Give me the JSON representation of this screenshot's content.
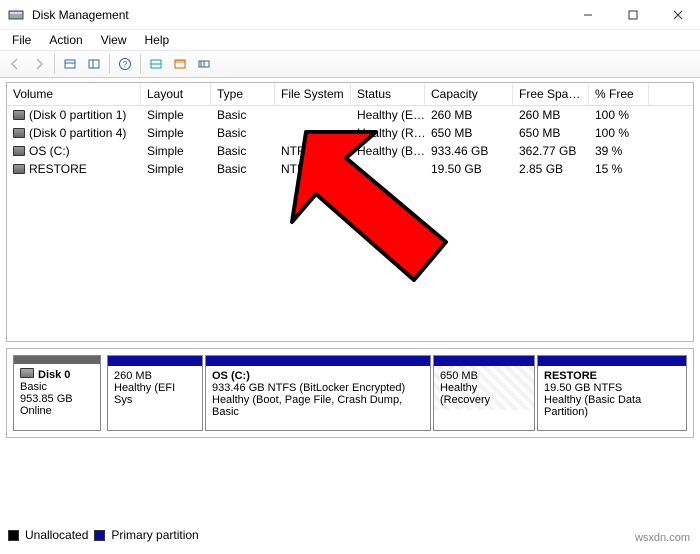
{
  "window": {
    "title": "Disk Management",
    "controls": {
      "minimize": "–",
      "maximize": "☐",
      "close": "✕"
    }
  },
  "menubar": {
    "items": [
      "File",
      "Action",
      "View",
      "Help"
    ]
  },
  "columns": {
    "volume": "Volume",
    "layout": "Layout",
    "type": "Type",
    "filesystem": "File System",
    "status": "Status",
    "capacity": "Capacity",
    "freespace": "Free Spa…",
    "pctfree": "% Free"
  },
  "volumes": [
    {
      "name": "(Disk 0 partition 1)",
      "layout": "Simple",
      "type": "Basic",
      "fs": "",
      "status": "Healthy (E…",
      "capacity": "260 MB",
      "free": "260 MB",
      "pct": "100 %"
    },
    {
      "name": "(Disk 0 partition 4)",
      "layout": "Simple",
      "type": "Basic",
      "fs": "",
      "status": "Healthy (R…",
      "capacity": "650 MB",
      "free": "650 MB",
      "pct": "100 %"
    },
    {
      "name": "OS (C:)",
      "layout": "Simple",
      "type": "Basic",
      "fs": "NTFS (BitLo…",
      "status": "Healthy (B…",
      "capacity": "933.46 GB",
      "free": "362.77 GB",
      "pct": "39 %"
    },
    {
      "name": "RESTORE",
      "layout": "Simple",
      "type": "Basic",
      "fs": "NTFS",
      "status": "",
      "capacity": "19.50 GB",
      "free": "2.85 GB",
      "pct": "15 %"
    }
  ],
  "disk": {
    "label": "Disk 0",
    "type": "Basic",
    "size": "953.85 GB",
    "state": "Online",
    "partitions": [
      {
        "title": "",
        "line1": "260 MB",
        "line2": "Healthy (EFI Sys"
      },
      {
        "title": "OS  (C:)",
        "line1": "933.46 GB NTFS (BitLocker Encrypted)",
        "line2": "Healthy (Boot, Page File, Crash Dump, Basic"
      },
      {
        "title": "",
        "line1": "650 MB",
        "line2": "Healthy (Recovery"
      },
      {
        "title": "RESTORE",
        "line1": "19.50 GB NTFS",
        "line2": "Healthy (Basic Data Partition)"
      }
    ]
  },
  "legend": {
    "unallocated": "Unallocated",
    "primary": "Primary partition"
  },
  "watermark": "wsxdn.com"
}
